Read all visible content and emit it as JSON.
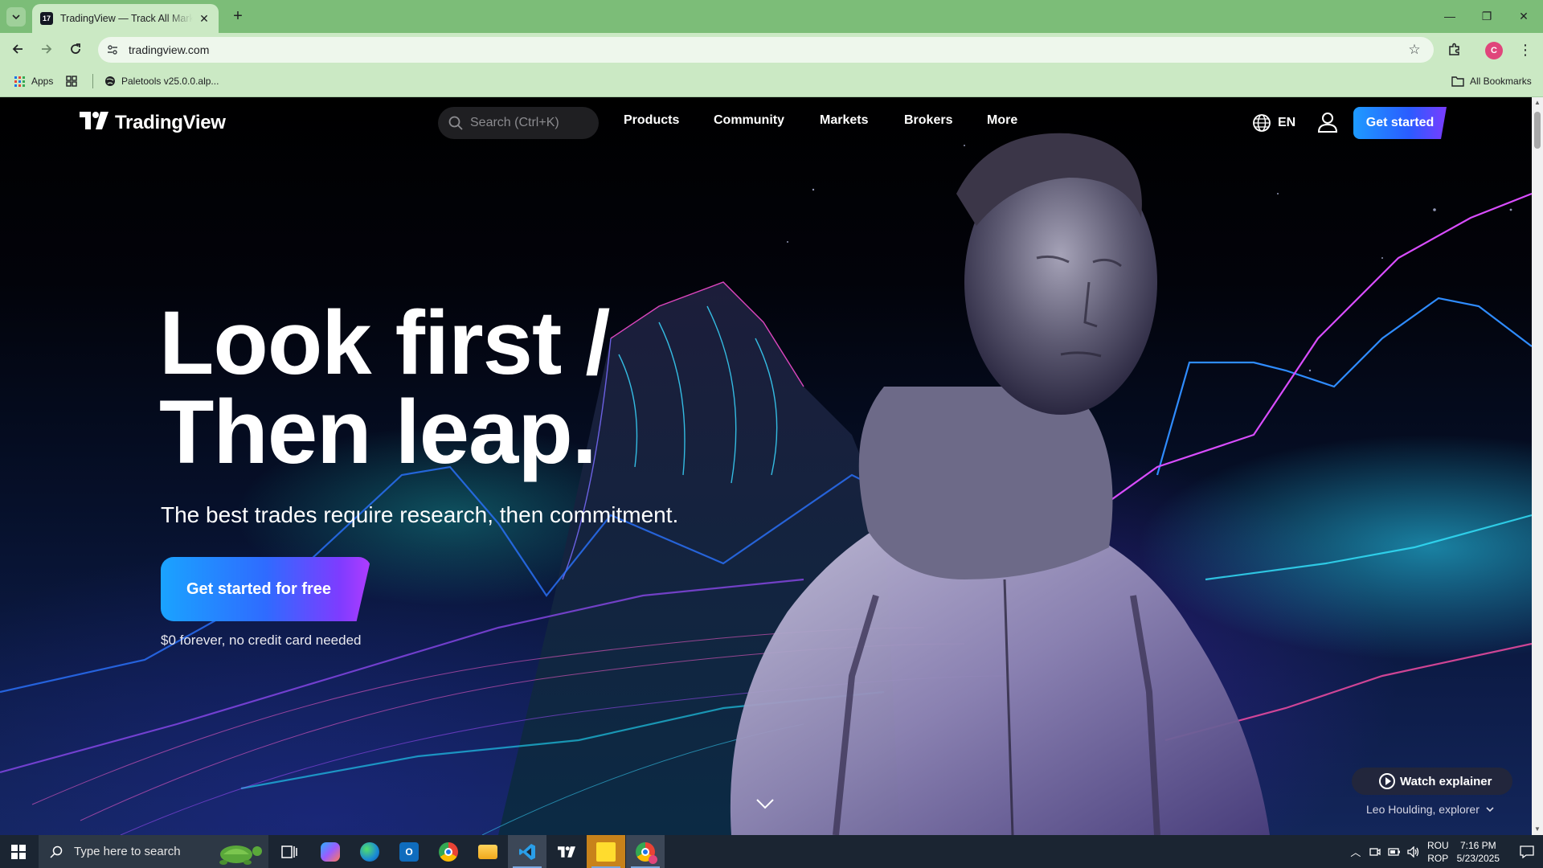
{
  "browser": {
    "tab_title": "TradingView — Track All Markets",
    "tab_favicon_text": "17",
    "url": "tradingview.com",
    "bookmarks": {
      "apps_label": "Apps",
      "paletools_label": "Paletools v25.0.0.alp...",
      "all_bookmarks_label": "All Bookmarks"
    },
    "profile_initial": "C"
  },
  "site": {
    "logo_text": "TradingView",
    "search_placeholder": "Search (Ctrl+K)",
    "nav": [
      "Products",
      "Community",
      "Markets",
      "Brokers",
      "More"
    ],
    "language": "EN",
    "header_cta": "Get started"
  },
  "hero": {
    "headline_line1": "Look first /",
    "headline_line2": "Then leap.",
    "subhead": "The best trades require research, then commitment.",
    "cta_label": "Get started for free",
    "cta_note": "$0 forever, no credit card needed",
    "watch_label": "Watch explainer",
    "credit": "Leo Houlding, explorer"
  },
  "taskbar": {
    "search_placeholder": "Type here to search",
    "apps": [
      "task-view",
      "copilot",
      "edge",
      "outlook",
      "chrome",
      "file-explorer",
      "vscode",
      "tradingview",
      "sticky-notes",
      "chrome-profile"
    ],
    "input_lang_line1": "ROU",
    "input_lang_line2": "ROP",
    "time": "7:16 PM",
    "date": "5/23/2025"
  },
  "colors": {
    "tabbar": "#7cbd78",
    "toolbar": "#cbe9c4",
    "cta_gradient_start": "#1aa3ff",
    "cta_gradient_end": "#b13cff",
    "taskbar": "#1b2532"
  }
}
